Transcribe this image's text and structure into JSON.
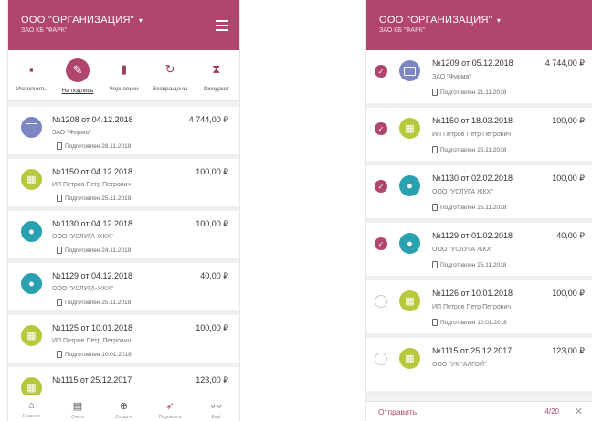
{
  "colors": {
    "brand": "#b0456d",
    "card_icon": "#7b86c2",
    "build_icon": "#b7c83d",
    "drop_icon": "#29a1b0"
  },
  "left": {
    "org_name": "ООО \"ОРГАНИЗАЦИЯ\"",
    "org_sub": "ЗАО КБ \"ФАРК\"",
    "tabs": [
      {
        "label": "Исполнить",
        "icon": "doc-check-icon"
      },
      {
        "label": "На подпись",
        "icon": "signature-icon"
      },
      {
        "label": "Черновики",
        "icon": "draft-icon"
      },
      {
        "label": "Возвращены",
        "icon": "return-icon"
      },
      {
        "label": "Ожидают",
        "icon": "hourglass-icon"
      }
    ],
    "items": [
      {
        "title": "№1208 от 04.12.2018",
        "amount": "4 744,00 ₽",
        "org": "ЗАО \"Фирма\"",
        "status": "Подготовлен 28.11.2018",
        "icon": "card-icon"
      },
      {
        "title": "№1150 от 04.12.2018",
        "amount": "100,00 ₽",
        "org": "ИП Петров Петр Петрович",
        "status": "Подготовлен 25.11.2018",
        "icon": "building-icon"
      },
      {
        "title": "№1130 от 04.12.2018",
        "amount": "100,00 ₽",
        "org": "ООО \"УСЛУГА ЖКХ\"",
        "status": "Подготовлен 24.11.2018",
        "icon": "drop-icon"
      },
      {
        "title": "№1129 от 04.12.2018",
        "amount": "40,00 ₽",
        "org": "ООО \"УСЛУГА-ЖКХ\"",
        "status": "Подготовлен 25.11.2018",
        "icon": "drop-icon"
      },
      {
        "title": "№1125 от 10.01.2018",
        "amount": "100,00 ₽",
        "org": "ИП Петров Пётр Петрович",
        "status": "Подготовлен 10.01.2018",
        "icon": "building-icon"
      },
      {
        "title": "№1115 от 25.12.2017",
        "amount": "123,00 ₽",
        "org": "",
        "status": "",
        "icon": "building-icon"
      }
    ],
    "nav": [
      {
        "label": "Главная",
        "icon": "home-icon"
      },
      {
        "label": "Счета",
        "icon": "doc-icon"
      },
      {
        "label": "Создать",
        "icon": "add-icon"
      },
      {
        "label": "Подписать",
        "icon": "send-icon"
      },
      {
        "label": "Ещё",
        "icon": "more-icon"
      }
    ]
  },
  "right": {
    "org_name": "ООО \"ОРГАНИЗАЦИЯ\"",
    "org_sub": "ЗАО КБ \"ФАРК\"",
    "items": [
      {
        "title": "№1209 от 05.12.2018",
        "amount": "4 744,00 ₽",
        "org": "ЗАО \"Фирма\"",
        "status": "Подготовлен 21.11.2018",
        "icon": "card-icon",
        "checked": true
      },
      {
        "title": "№1150 от 18.03.2018",
        "amount": "100,00 ₽",
        "org": "ИП Петров Петр Петрович",
        "status": "Подготовлен 25.11.2018",
        "icon": "building-icon",
        "checked": true
      },
      {
        "title": "№1130 от 02.02.2018",
        "amount": "100,00 ₽",
        "org": "ООО \"УСЛУГА ЖКХ\"",
        "status": "Подготовлен 25.11.2018",
        "icon": "drop-icon",
        "checked": true
      },
      {
        "title": "№1129 от 01.02.2018",
        "amount": "40,00 ₽",
        "org": "ООО \"УСЛУГА ЖКХ\"",
        "status": "Подготовлен 25.11.2018",
        "icon": "drop-icon",
        "checked": true
      },
      {
        "title": "№1126 от 10.01.2018",
        "amount": "100,00 ₽",
        "org": "ИП Петров Петр Петрович",
        "status": "Подготовлен 10.01.2018",
        "icon": "building-icon",
        "checked": false
      },
      {
        "title": "№1115 от 25.12.2017",
        "amount": "123,00 ₽",
        "org": "ООО \"УК \"АЛГОЙ\"",
        "status": "",
        "icon": "building-icon",
        "checked": false
      }
    ],
    "send_label": "Отправить",
    "counter": "4/20"
  }
}
